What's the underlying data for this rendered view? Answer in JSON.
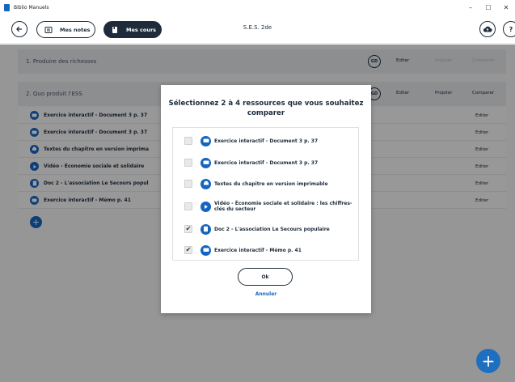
{
  "window": {
    "title": "Biblio Manuels",
    "controls": {
      "minimize": "–",
      "maximize": "☐",
      "close": "✕"
    }
  },
  "header": {
    "mes_notes": "Mes notes",
    "mes_cours": "Mes cours",
    "title": "S.E.S. 2de",
    "help": "?"
  },
  "chapters": [
    {
      "title": "1. Produire des richesses",
      "gd": "GD",
      "edit": "Editer",
      "project": "Projeter",
      "compare": "Comparer"
    },
    {
      "title": "2. Quo produit l'ESS",
      "gd": "GD",
      "edit": "Editer",
      "project": "Projeter",
      "compare": "Comparer"
    }
  ],
  "resources": [
    {
      "label": "Exercice interactif - Document 3 p. 37",
      "icon": "chat-icon",
      "edit": "Editer"
    },
    {
      "label": "Exercice interactif - Document 3 p. 37",
      "icon": "chat-icon",
      "edit": "Editer"
    },
    {
      "label": "Textes du chapitre en version imprima",
      "icon": "print-icon",
      "edit": "Editer"
    },
    {
      "label": "Vidéo - Économie sociale et solidaire",
      "icon": "play-icon",
      "edit": "Editer"
    },
    {
      "label": "Doc 2 - L'association Le Secours popul",
      "icon": "document-icon",
      "edit": "Editer"
    },
    {
      "label": "Exercice interactif - Mémo p. 41",
      "icon": "chat-icon",
      "edit": "Editer"
    }
  ],
  "modal": {
    "title": "Sélectionnez 2 à 4 ressources que vous souhaitez comparer",
    "items": [
      {
        "label": "Exercice interactif - Document 3 p. 37",
        "icon": "chat-icon",
        "checked": false
      },
      {
        "label": "Exercice interactif - Document 3 p. 37",
        "icon": "chat-icon",
        "checked": false
      },
      {
        "label": "Textes du chapitre en version imprimable",
        "icon": "print-icon",
        "checked": false
      },
      {
        "label": "Vidéo - Économie sociale et solidaire : les chiffres-clés du secteur",
        "icon": "play-icon",
        "checked": false
      },
      {
        "label": "Doc 2 - L'association Le Secours populaire",
        "icon": "document-icon",
        "checked": true
      },
      {
        "label": "Exercice interactif - Mémo p. 41",
        "icon": "chat-icon",
        "checked": true
      }
    ],
    "ok": "Ok",
    "cancel": "Annuler",
    "check_mark": "✔"
  },
  "fab": {
    "plus": "+"
  },
  "colors": {
    "navy": "#1d2b3a",
    "accent": "#1565c0",
    "overlay": "rgba(0,0,0,0.38)"
  }
}
